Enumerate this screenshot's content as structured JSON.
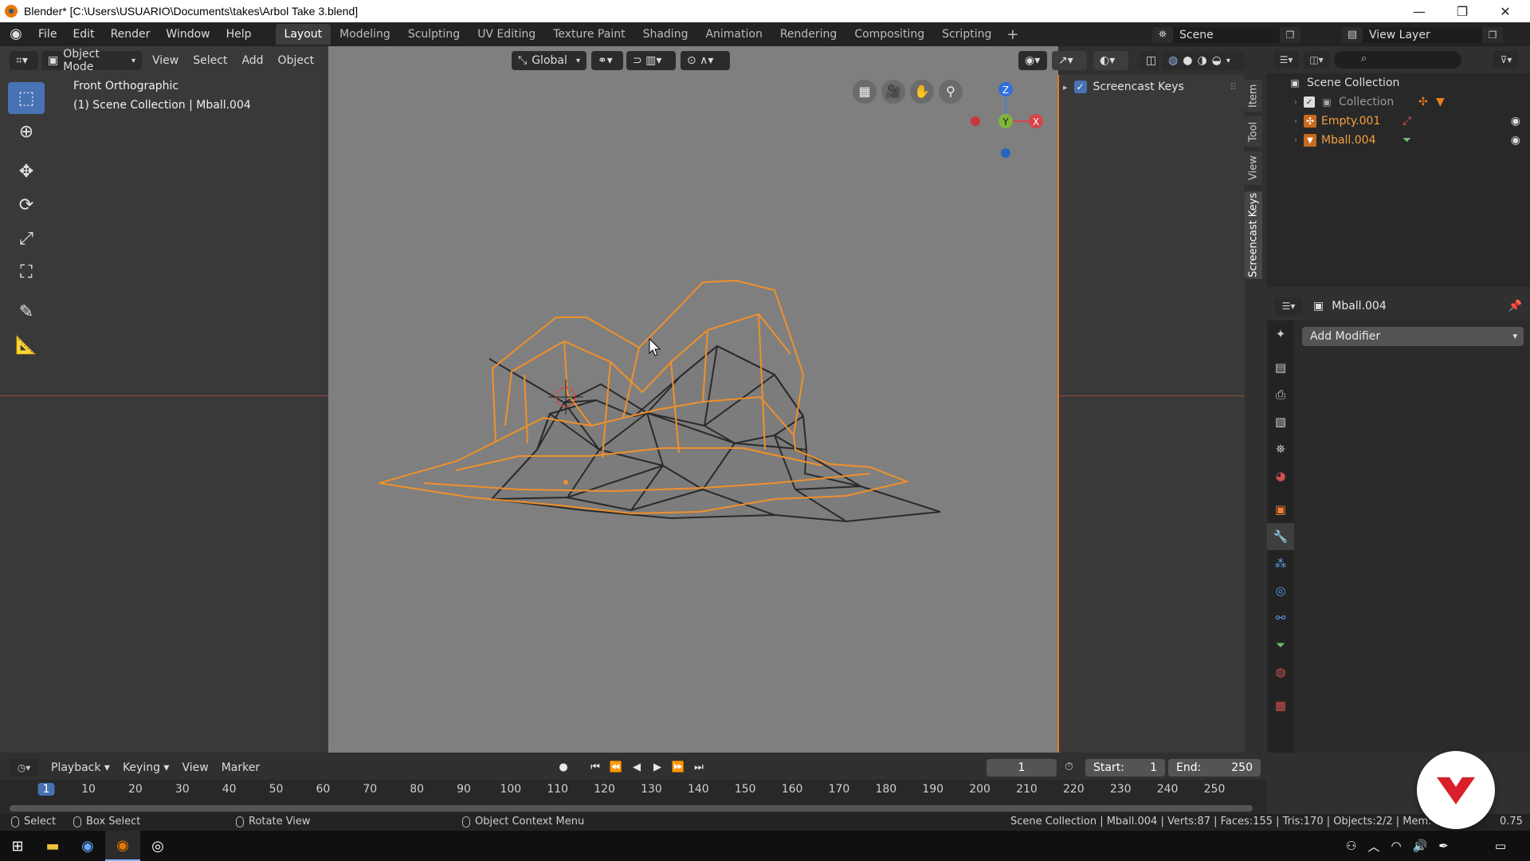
{
  "window": {
    "title": "Blender* [C:\\Users\\USUARIO\\Documents\\takes\\Arbol Take 3.blend]",
    "minimize": "—",
    "maximize": "❐",
    "close": "✕"
  },
  "menubar": {
    "menus": [
      "File",
      "Edit",
      "Render",
      "Window",
      "Help"
    ],
    "workspaces": [
      "Layout",
      "Modeling",
      "Sculpting",
      "UV Editing",
      "Texture Paint",
      "Shading",
      "Animation",
      "Rendering",
      "Compositing",
      "Scripting"
    ],
    "active_workspace": "Layout",
    "add_workspace": "+",
    "scene": "Scene",
    "view_layer": "View Layer"
  },
  "viewport": {
    "mode": "Object Mode",
    "menus": [
      "View",
      "Select",
      "Add",
      "Object"
    ],
    "transform_orientation": "Global",
    "view_name": "Front Orthographic",
    "view_context": "(1) Scene Collection | Mball.004",
    "gizmo_axes": {
      "z": "Z",
      "y": "Y",
      "x": "X"
    }
  },
  "npanel": {
    "section": "Screencast Keys",
    "tabs": [
      "Item",
      "Tool",
      "View",
      "Screencast Keys"
    ],
    "active_tab": "Screencast Keys"
  },
  "outliner": {
    "search_placeholder": "",
    "rows": [
      {
        "label": "Scene Collection",
        "icon": "collection-icon"
      },
      {
        "label": "Collection",
        "icon": "collection-icon"
      },
      {
        "label": "Empty.001",
        "icon": "empty-icon"
      },
      {
        "label": "Mball.004",
        "icon": "metaball-icon"
      }
    ]
  },
  "properties": {
    "object_name": "Mball.004",
    "add_modifier": "Add Modifier"
  },
  "timeline": {
    "menus": [
      "Playback",
      "Keying",
      "View",
      "Marker"
    ],
    "current_frame": "1",
    "start_label": "Start:",
    "start": "1",
    "end_label": "End:",
    "end": "250",
    "ticks": [
      "1",
      "10",
      "20",
      "30",
      "40",
      "50",
      "60",
      "70",
      "80",
      "90",
      "100",
      "110",
      "120",
      "130",
      "140",
      "150",
      "160",
      "170",
      "180",
      "190",
      "200",
      "210",
      "220",
      "230",
      "240",
      "250"
    ]
  },
  "statusbar": {
    "select": "Select",
    "box_select": "Box Select",
    "rotate_view": "Rotate View",
    "context_menu": "Object Context Menu",
    "stats": "Scene Collection | Mball.004 | Verts:87 | Faces:155 | Tris:170 | Objects:2/2 | Mem: 37.0",
    "version": "0.75"
  },
  "colors": {
    "accent": "#4772b3",
    "selection_orange": "#f0902a",
    "viewport_bg": "#7f7f7f"
  }
}
